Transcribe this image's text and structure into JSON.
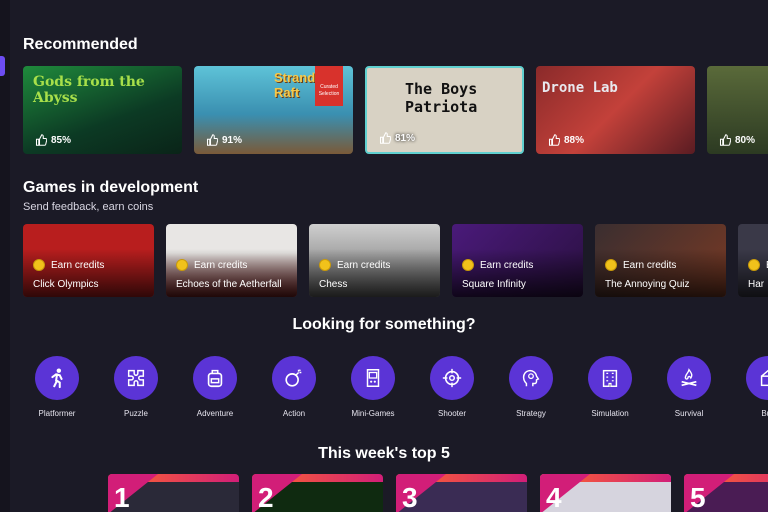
{
  "recommended": {
    "title": "Recommended",
    "cards": [
      {
        "name": "Gods from the Abyss",
        "rating": "85%",
        "badge": ""
      },
      {
        "name": "Stranded Raft",
        "rating": "91%",
        "badge": "Curated Selection"
      },
      {
        "name": "The Boys Patriota",
        "rating": "81%",
        "badge": ""
      },
      {
        "name": "Drone Lab",
        "rating": "88%",
        "badge": ""
      },
      {
        "name": "",
        "rating": "80%",
        "badge": ""
      }
    ]
  },
  "development": {
    "title": "Games in development",
    "subtitle": "Send feedback, earn coins",
    "earn_label": "Earn credits",
    "cards": [
      {
        "name": "Click Olympics"
      },
      {
        "name": "Echoes of the Aetherfall"
      },
      {
        "name": "Chess"
      },
      {
        "name": "Square Infinity"
      },
      {
        "name": "The Annoying Quiz"
      },
      {
        "name": "Har"
      }
    ]
  },
  "categories": {
    "title": "Looking for something?",
    "items": [
      {
        "label": "Platformer",
        "icon": "runner-icon"
      },
      {
        "label": "Puzzle",
        "icon": "puzzle-icon"
      },
      {
        "label": "Adventure",
        "icon": "backpack-icon"
      },
      {
        "label": "Action",
        "icon": "bomb-icon"
      },
      {
        "label": "Mini-Games",
        "icon": "arcade-icon"
      },
      {
        "label": "Shooter",
        "icon": "crosshair-icon"
      },
      {
        "label": "Strategy",
        "icon": "brain-icon"
      },
      {
        "label": "Simulation",
        "icon": "building-icon"
      },
      {
        "label": "Survival",
        "icon": "campfire-icon"
      },
      {
        "label": "Buil",
        "icon": "build-icon"
      }
    ]
  },
  "top5": {
    "title": "This week's top 5",
    "items": [
      {
        "rank": "1"
      },
      {
        "rank": "2"
      },
      {
        "rank": "3"
      },
      {
        "rank": "4"
      },
      {
        "rank": "5"
      }
    ]
  },
  "colors": {
    "background": "#1b1a26",
    "accent": "#5b34d6",
    "coin": "#f1c21b",
    "rank_gradient_start": "#ff6a2a",
    "rank_gradient_end": "#d21e78"
  }
}
